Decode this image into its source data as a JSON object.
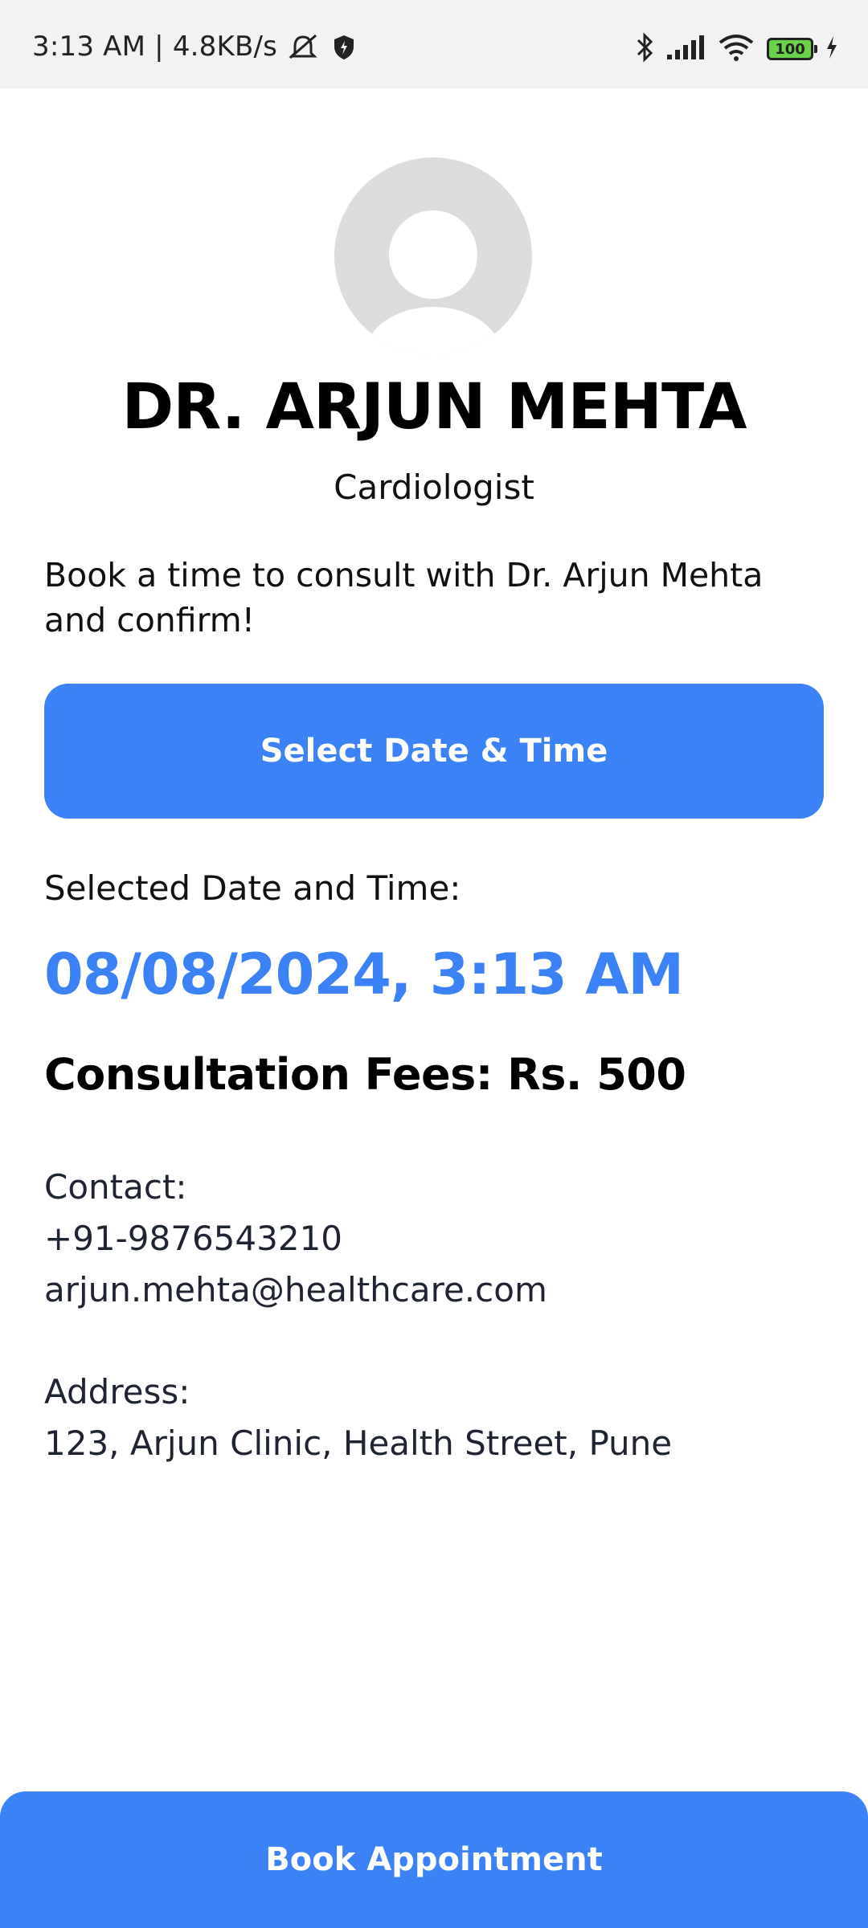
{
  "status_bar": {
    "time_speed": "3:13 AM | 4.8KB/s",
    "battery_level": "100",
    "icons": [
      "mute-icon",
      "shield-icon",
      "bluetooth-icon",
      "signal-icon",
      "wifi-icon",
      "battery-icon",
      "charging-icon"
    ]
  },
  "doctor": {
    "name": "DR. ARJUN MEHTA",
    "specialty": "Cardiologist",
    "intro_line1": "Book a time to consult with Dr. Arjun Mehta",
    "intro_line2": "and confirm!"
  },
  "booking": {
    "select_button_label": "Select Date & Time",
    "selected_label": "Selected Date and Time:",
    "selected_value": "08/08/2024, 3:13 AM",
    "fees": "Consultation Fees: Rs. 500",
    "book_button_label": "Book Appointment"
  },
  "contact": {
    "label": "Contact:",
    "phone": "+91-9876543210",
    "email": "arjun.mehta@healthcare.com"
  },
  "address": {
    "label": "Address:",
    "value": "123, Arjun Clinic, Health Street, Pune"
  },
  "colors": {
    "accent": "#3b82f6",
    "status_bar_bg": "#f2f2f2",
    "avatar_bg": "#dddddd"
  }
}
